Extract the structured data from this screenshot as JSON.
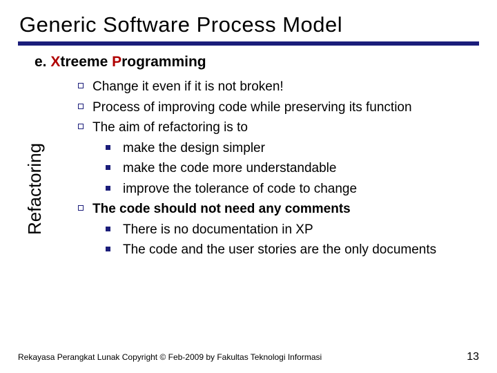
{
  "title": "Generic Software Process Model",
  "subtitle": {
    "pre": "e. ",
    "x": "X",
    "mid": "treeme ",
    "p": "P",
    "post": "rogramming"
  },
  "sidebar_label": "Refactoring",
  "bullets": [
    {
      "level": 1,
      "bold": false,
      "text": "Change it even if it is not broken!"
    },
    {
      "level": 1,
      "bold": false,
      "text": "Process of improving code while preserving its function"
    },
    {
      "level": 1,
      "bold": false,
      "text": "The aim of refactoring is to"
    },
    {
      "level": 2,
      "bold": false,
      "text": "make the design simpler"
    },
    {
      "level": 2,
      "bold": false,
      "text": "make the code more understandable"
    },
    {
      "level": 2,
      "bold": false,
      "text": "improve the tolerance of code to change"
    },
    {
      "level": 1,
      "bold": true,
      "text": "The code should not need any comments"
    },
    {
      "level": 2,
      "bold": false,
      "text": "There is no documentation in XP"
    },
    {
      "level": 2,
      "bold": false,
      "text": "The code and the user stories are the only documents"
    }
  ],
  "footer": "Rekayasa Perangkat Lunak Copyright © Feb-2009 by Fakultas Teknologi Informasi",
  "page_number": "13"
}
